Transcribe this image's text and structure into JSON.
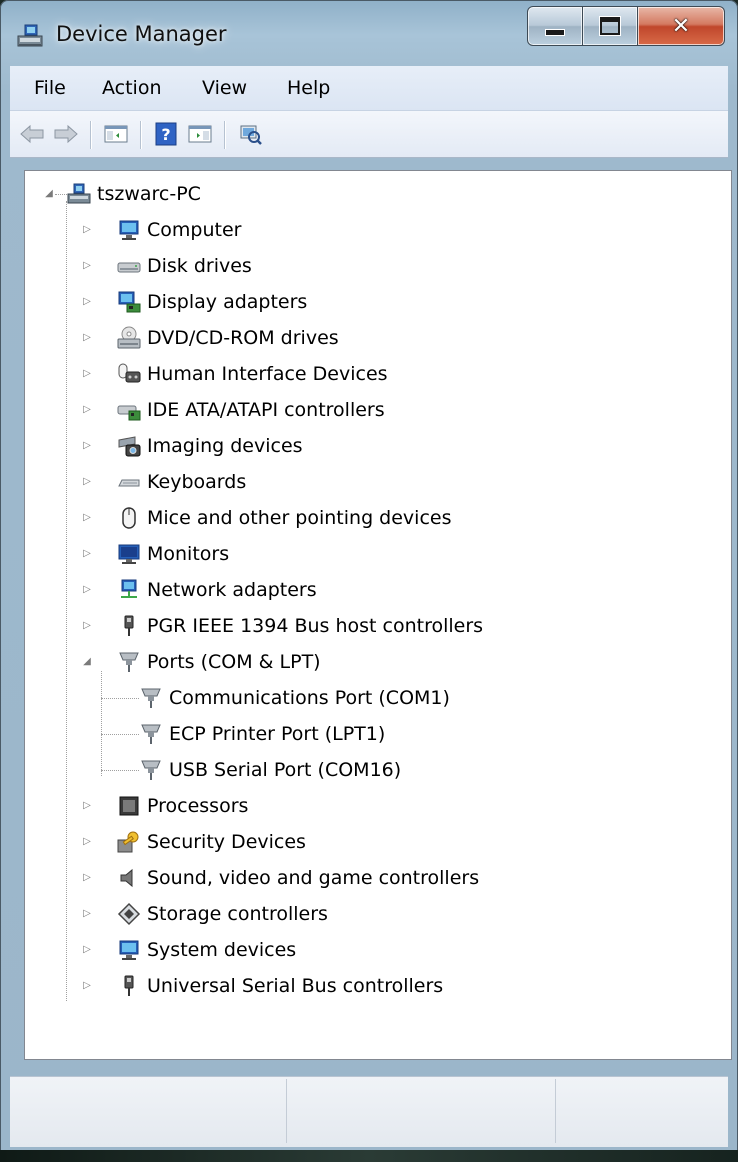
{
  "window": {
    "title": "Device Manager"
  },
  "menu": {
    "items": [
      "File",
      "Action",
      "View",
      "Help"
    ]
  },
  "toolbar": {
    "buttons": [
      "back-arrow-icon",
      "forward-arrow-icon",
      "show-hide-console-tree-icon",
      "help-icon",
      "show-action-pane-icon",
      "scan-hardware-icon"
    ]
  },
  "tree": {
    "root": "tszwarc-PC",
    "categories": [
      {
        "label": "Computer",
        "icon": "computer-icon",
        "expanded": false
      },
      {
        "label": "Disk drives",
        "icon": "disk-drive-icon",
        "expanded": false
      },
      {
        "label": "Display adapters",
        "icon": "display-adapter-icon",
        "expanded": false
      },
      {
        "label": "DVD/CD-ROM drives",
        "icon": "dvd-drive-icon",
        "expanded": false
      },
      {
        "label": "Human Interface Devices",
        "icon": "hid-icon",
        "expanded": false
      },
      {
        "label": "IDE ATA/ATAPI controllers",
        "icon": "ide-controller-icon",
        "expanded": false
      },
      {
        "label": "Imaging devices",
        "icon": "imaging-device-icon",
        "expanded": false
      },
      {
        "label": "Keyboards",
        "icon": "keyboard-icon",
        "expanded": false
      },
      {
        "label": "Mice and other pointing devices",
        "icon": "mouse-icon",
        "expanded": false
      },
      {
        "label": "Monitors",
        "icon": "monitor-icon",
        "expanded": false
      },
      {
        "label": "Network adapters",
        "icon": "network-adapter-icon",
        "expanded": false
      },
      {
        "label": "PGR IEEE 1394 Bus host controllers",
        "icon": "firewire-icon",
        "expanded": false
      },
      {
        "label": "Ports (COM & LPT)",
        "icon": "port-icon",
        "expanded": true,
        "children": [
          {
            "label": "Communications Port (COM1)",
            "icon": "port-icon"
          },
          {
            "label": "ECP Printer Port (LPT1)",
            "icon": "port-icon"
          },
          {
            "label": "USB Serial Port (COM16)",
            "icon": "port-icon"
          }
        ]
      },
      {
        "label": "Processors",
        "icon": "processor-icon",
        "expanded": false
      },
      {
        "label": "Security Devices",
        "icon": "security-key-icon",
        "expanded": false
      },
      {
        "label": "Sound, video and game controllers",
        "icon": "speaker-icon",
        "expanded": false
      },
      {
        "label": "Storage controllers",
        "icon": "storage-controller-icon",
        "expanded": false
      },
      {
        "label": "System devices",
        "icon": "system-device-icon",
        "expanded": false
      },
      {
        "label": "Universal Serial Bus controllers",
        "icon": "usb-icon",
        "expanded": false
      }
    ]
  },
  "statusbar": {
    "panes": [
      "",
      "",
      ""
    ]
  },
  "colors": {
    "menubar": "#dbe5f3",
    "tree_bg": "#ffffff",
    "close_button": "#c0472c"
  }
}
